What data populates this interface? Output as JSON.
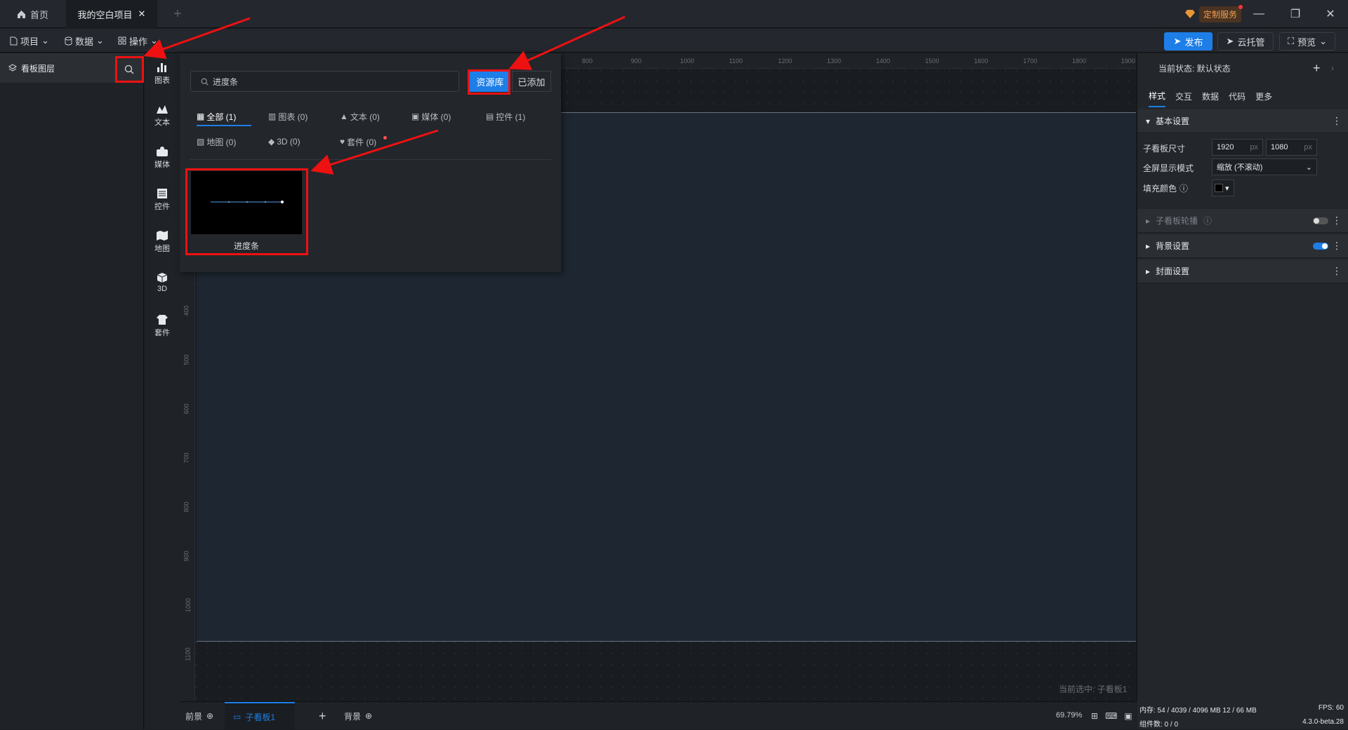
{
  "titlebar": {
    "home_tab": "首页",
    "project_tab": "我的空白项目",
    "custom_service": "定制服务"
  },
  "toolbar": {
    "menu_project": "项目",
    "menu_data": "数据",
    "menu_operate": "操作",
    "publish": "发布",
    "cloud_host": "云托管",
    "preview": "预览"
  },
  "layers": {
    "title": "看板图层"
  },
  "categories": [
    {
      "label": "图表",
      "icon": "chart-icon"
    },
    {
      "label": "文本",
      "icon": "text-icon"
    },
    {
      "label": "媒体",
      "icon": "media-icon"
    },
    {
      "label": "控件",
      "icon": "control-icon"
    },
    {
      "label": "地图",
      "icon": "map-icon"
    },
    {
      "label": "3D",
      "icon": "cube-icon"
    },
    {
      "label": "套件",
      "icon": "kit-icon"
    }
  ],
  "resource": {
    "search_value": "进度条",
    "library_button": "资源库",
    "added_button": "已添加",
    "filters": [
      "全部 (1)",
      "图表 (0)",
      "文本 (0)",
      "媒体 (0)",
      "控件 (1)",
      "地图 (0)",
      "3D (0)",
      "套件 (0)"
    ],
    "asset_name": "进度条"
  },
  "ruler": {
    "top": [
      "800",
      "900",
      "1000",
      "1100",
      "1200",
      "1300",
      "1400",
      "1500",
      "1600",
      "1700",
      "1800",
      "1900"
    ],
    "left": [
      "400",
      "500",
      "600",
      "700",
      "800",
      "900",
      "1000",
      "1100"
    ]
  },
  "canvas": {
    "current_selected": "当前选中: 子看板1"
  },
  "bottom": {
    "foreground": "前景",
    "sub_board": "子看板1",
    "background": "背景",
    "zoom": "69.79%"
  },
  "props": {
    "state_label": "当前状态: 默认状态",
    "tabs": [
      "样式",
      "交互",
      "数据",
      "代码",
      "更多"
    ],
    "basic_settings": "基本设置",
    "board_size_label": "子看板尺寸",
    "width": "1920",
    "height": "1080",
    "unit": "px",
    "fullscreen_label": "全屏显示模式",
    "fullscreen_value": "缩放 (不滚动)",
    "fill_color_label": "填充颜色",
    "carousel": "子看板轮播",
    "bg_settings": "背景设置",
    "cover_settings": "封面设置"
  },
  "status": {
    "memory": "内存: 54 / 4039 / 4096 MB 12 / 66 MB",
    "fps": "FPS: 60",
    "components": "组件数: 0 / 0",
    "version": "4.3.0-beta.28"
  },
  "colors": {
    "accent": "#1d7ee8",
    "annotation": "#e11111"
  }
}
